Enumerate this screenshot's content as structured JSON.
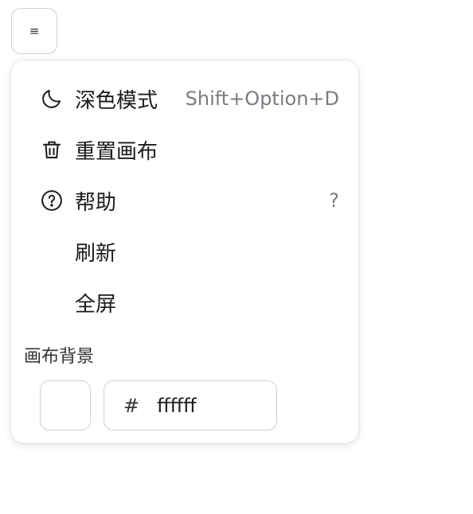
{
  "menu_trigger": {
    "glyph": "≡",
    "icon": "hamburger-icon"
  },
  "menu": {
    "items": [
      {
        "label": "深色模式",
        "shortcut": "Shift+Option+D",
        "icon": "moon-icon"
      },
      {
        "label": "重置画布",
        "shortcut": "",
        "icon": "trash-icon"
      },
      {
        "label": "帮助",
        "shortcut": "?",
        "icon": "help-circle-icon"
      },
      {
        "label": "刷新",
        "shortcut": ""
      },
      {
        "label": "全屏",
        "shortcut": ""
      }
    ]
  },
  "canvas_background": {
    "label": "画布背景",
    "hash": "#",
    "value": "ffffff",
    "swatch_color": "#ffffff"
  }
}
